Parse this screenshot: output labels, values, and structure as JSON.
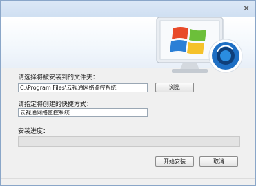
{
  "window": {
    "close_glyph": "✕"
  },
  "header": {
    "monitor_icon": "windows-monitor-camera-icon",
    "colors": {
      "flag_red": "#e84a2a",
      "flag_green": "#6cbf3a",
      "flag_blue": "#2b7fd6",
      "flag_yellow": "#f5c22a",
      "camera_blue": "#1e6fc4"
    }
  },
  "install_dir": {
    "label": "请选择将被安装到的文件夹：",
    "value": "C:\\Program Files\\云视通网络监控系统",
    "browse_label": "浏览"
  },
  "shortcut": {
    "label": "请指定将创建的快捷方式：",
    "value": "云视通网络监控系统"
  },
  "progress": {
    "label": "安装进度：",
    "value": 0
  },
  "footer": {
    "start_label": "开始安装",
    "cancel_label": "取消"
  }
}
